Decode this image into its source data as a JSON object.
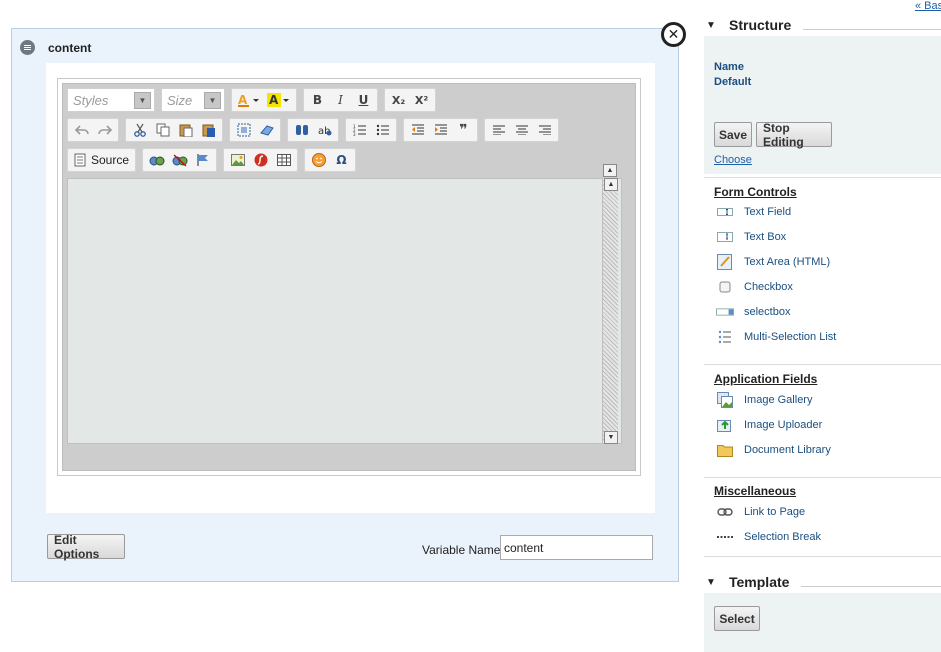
{
  "panel": {
    "title": "content",
    "edit_options_label": "Edit Options",
    "variable_name_label": "Variable Name",
    "variable_name_value": "content"
  },
  "toolbar": {
    "styles_label": "Styles",
    "size_label": "Size",
    "bold": "B",
    "italic": "I",
    "underline": "U",
    "subscript": "X₂",
    "superscript": "X²",
    "source_label": "Source",
    "omega": "Ω"
  },
  "sidebar": {
    "top_link": "« Bas",
    "structure": {
      "title": "Structure",
      "name_label": "Name",
      "name_value": "Default",
      "save_label": "Save",
      "stop_editing_label": "Stop Editing",
      "choose_label": "Choose"
    },
    "form_controls": {
      "title": "Form Controls",
      "items": [
        {
          "label": "Text Field",
          "icon": "text-field-icon"
        },
        {
          "label": "Text Box",
          "icon": "text-box-icon"
        },
        {
          "label": "Text Area (HTML)",
          "icon": "text-area-html-icon"
        },
        {
          "label": "Checkbox",
          "icon": "checkbox-icon"
        },
        {
          "label": "selectbox",
          "icon": "selectbox-icon"
        },
        {
          "label": "Multi-Selection List",
          "icon": "multi-selection-list-icon"
        }
      ]
    },
    "application_fields": {
      "title": "Application Fields",
      "items": [
        {
          "label": "Image Gallery",
          "icon": "image-gallery-icon"
        },
        {
          "label": "Image Uploader",
          "icon": "image-uploader-icon"
        },
        {
          "label": "Document Library",
          "icon": "folder-icon"
        }
      ]
    },
    "miscellaneous": {
      "title": "Miscellaneous",
      "items": [
        {
          "label": "Link to Page",
          "icon": "link-icon"
        },
        {
          "label": "Selection Break",
          "icon": "dotted-line-icon"
        }
      ]
    },
    "template": {
      "title": "Template",
      "select_label": "Select"
    }
  },
  "colors": {
    "panel_bg": "#eaf2fb",
    "link": "#1f5fa8",
    "sidebar_bg": "#edf2f3"
  }
}
